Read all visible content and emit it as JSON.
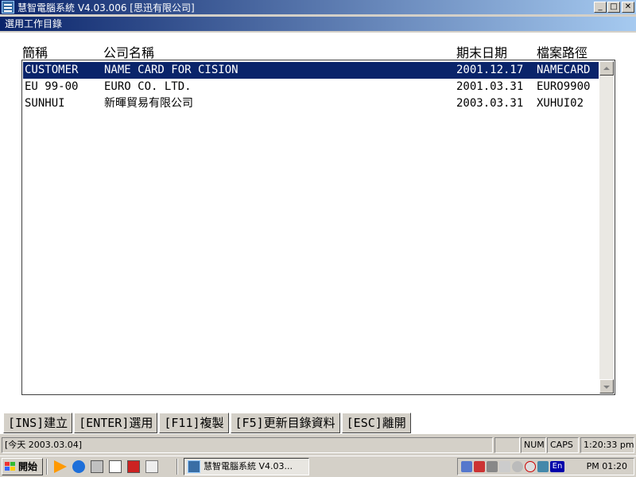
{
  "window": {
    "title": "慧智電腦系統 V4.03.006 [思迅有限公司]",
    "subtitle": "選用工作目錄",
    "minimize": "_",
    "maximize": "□",
    "close": "✕"
  },
  "columns": {
    "code": "簡稱",
    "name": "公司名稱",
    "date": "期末日期",
    "path": "檔案路徑"
  },
  "rows": [
    {
      "code": " CUSTOMER",
      "name": "NAME CARD FOR CISION",
      "date": "2001.12.17",
      "path": "NAMECARD",
      "selected": true
    },
    {
      "code": "EU 99-00",
      "name": "EURO CO. LTD.",
      "date": "2001.03.31",
      "path": "EURO9900",
      "selected": false
    },
    {
      "code": "SUNHUI",
      "name": "新暉貿易有限公司",
      "date": "2003.03.31",
      "path": "XUHUI02",
      "selected": false
    }
  ],
  "fkeys": {
    "ins": "[INS]建立",
    "enter": "[ENTER]選用",
    "f11": "[F11]複製",
    "f5": "[F5]更新目錄資料",
    "esc": "[ESC]離開"
  },
  "status": {
    "today": "[今天 2003.03.04]",
    "num": "NUM",
    "caps": "CAPS",
    "time": "1:20:33 pm"
  },
  "taskbar": {
    "start": "開始",
    "task_label": "慧智電腦系統 V4.03...",
    "clock": "PM 01:20",
    "lang": "En"
  },
  "colors": {
    "title_start": "#0a246a",
    "title_end": "#a6caf0",
    "selection": "#0a246a"
  }
}
